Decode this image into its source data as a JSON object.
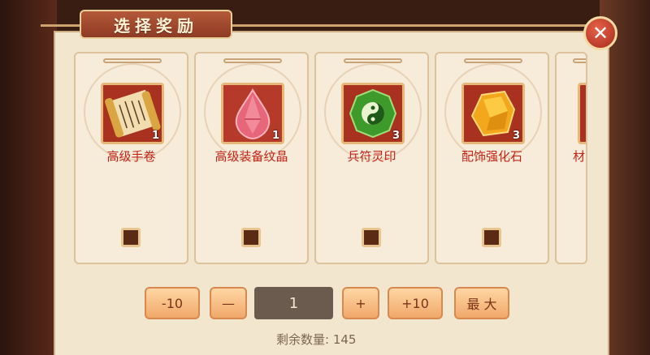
{
  "dialog": {
    "title": "选择奖励",
    "close_glyph": "✕"
  },
  "items": [
    {
      "name": "高级手卷",
      "count": "1",
      "icon": "scroll-icon"
    },
    {
      "name": "高级装备纹晶",
      "count": "1",
      "icon": "red-crystal-icon"
    },
    {
      "name": "兵符灵印",
      "count": "3",
      "icon": "yin-yang-seal-icon"
    },
    {
      "name": "配饰强化石",
      "count": "3",
      "icon": "amber-stone-icon"
    },
    {
      "name": "材",
      "count": "",
      "icon": "partial-item-icon"
    }
  ],
  "controls": {
    "minus10": "-10",
    "minus1": "—",
    "quantity": "1",
    "plus1": "+",
    "plus10": "+10",
    "max": "最 大"
  },
  "remaining": {
    "label": "剩余数量: 145"
  },
  "colors": {
    "panel": "#f3e6cf",
    "title_tab": "#a5472d",
    "item_name": "#c02418",
    "button": "#f5b47a"
  }
}
